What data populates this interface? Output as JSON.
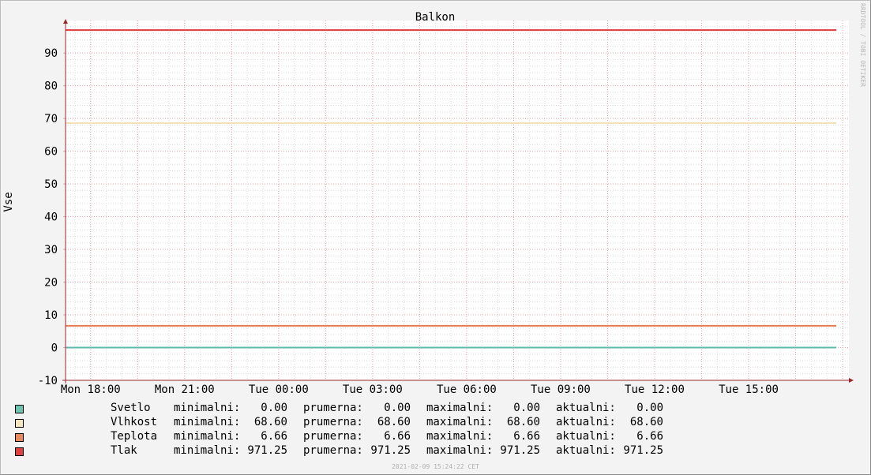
{
  "chart_data": {
    "type": "line",
    "title": "Balkon",
    "ylabel": "Vse",
    "watermark": "RRDTOOL / TOBI OETIKER",
    "timestamp": "2021-02-09 15:24:22 CET",
    "ylim": [
      -10,
      98
    ],
    "y_ticks": [
      -10,
      0,
      10,
      20,
      30,
      40,
      50,
      60,
      70,
      80,
      90
    ],
    "y_minor_step": 2,
    "grid": true,
    "x_hours_range": [
      -0.8,
      24.2
    ],
    "x_ticks": [
      {
        "label": "Mon 18:00",
        "h": 0
      },
      {
        "label": "Mon 21:00",
        "h": 3
      },
      {
        "label": "Tue 00:00",
        "h": 6
      },
      {
        "label": "Tue 03:00",
        "h": 9
      },
      {
        "label": "Tue 06:00",
        "h": 12
      },
      {
        "label": "Tue 09:00",
        "h": 15
      },
      {
        "label": "Tue 12:00",
        "h": 18
      },
      {
        "label": "Tue 15:00",
        "h": 21
      }
    ],
    "series_x_range": [
      -0.8,
      23.8
    ],
    "series": [
      {
        "name": "Svetlo",
        "color": "#5fb8a8",
        "values": [
          0.0,
          0.0
        ]
      },
      {
        "name": "Vlhkost",
        "color": "#f3e2b8",
        "values": [
          68.6,
          68.6
        ]
      },
      {
        "name": "Teplota",
        "color": "#e87a50",
        "values": [
          6.66,
          6.66
        ]
      },
      {
        "name": "Tlak",
        "color": "#e03a3a",
        "values": [
          971.25,
          971.25
        ]
      }
    ],
    "legend": {
      "labels": {
        "min": "minimalni:",
        "avg": "prumerna:",
        "max": "maximalni:",
        "cur": "aktualni:"
      },
      "rows": [
        {
          "name": "Svetlo",
          "color": "#6fc4b0",
          "min": "0.00",
          "avg": "0.00",
          "max": "0.00",
          "cur": "0.00"
        },
        {
          "name": "Vlhkost",
          "color": "#f6e6c0",
          "min": "68.60",
          "avg": "68.60",
          "max": "68.60",
          "cur": "68.60"
        },
        {
          "name": "Teplota",
          "color": "#e88a60",
          "min": "6.66",
          "avg": "6.66",
          "max": "6.66",
          "cur": "6.66"
        },
        {
          "name": "Tlak",
          "color": "#e04040",
          "min": "971.25",
          "avg": "971.25",
          "max": "971.25",
          "cur": "971.25"
        }
      ]
    }
  }
}
